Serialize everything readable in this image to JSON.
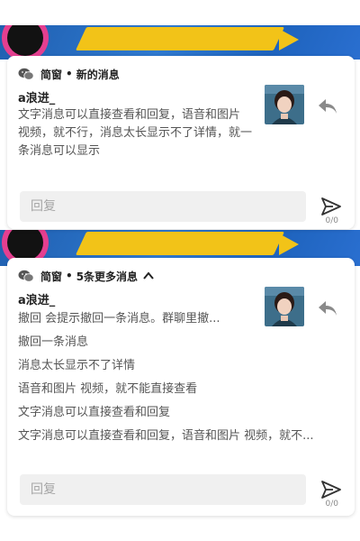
{
  "wallpaper": {
    "tag": ""
  },
  "notifications": [
    {
      "app_name": "简窗",
      "separator": "•",
      "subtitle": "新的消息",
      "sender": "a浪进_",
      "message": " 文字消息可以直接查看和回复，语音和图片 视频，就不行，消息太长显示不了详情，就一条消息可以显示",
      "reply_placeholder": "回复",
      "counter": "0/0"
    },
    {
      "app_name": "简窗",
      "separator": "•",
      "subtitle": "5条更多消息",
      "sender": "a浪进_",
      "messages": [
        "撤回 会提示撤回一条消息。群聊里撤...",
        "撤回一条消息",
        "消息太长显示不了详情",
        "语音和图片 视频，就不能直接查看",
        "文字消息可以直接查看和回复",
        "文字消息可以直接查看和回复，语音和图片 视频，就不..."
      ],
      "reply_placeholder": "回复",
      "counter": "0/0"
    }
  ],
  "icons": {
    "app": "wechat-icon",
    "reply": "reply-arrow-icon",
    "send": "send-icon",
    "expand": "chevron-up-icon"
  },
  "colors": {
    "wallpaper_blue": "#2f79cf",
    "wallpaper_yellow": "#f2c318",
    "accent_pink": "#e43f90"
  }
}
